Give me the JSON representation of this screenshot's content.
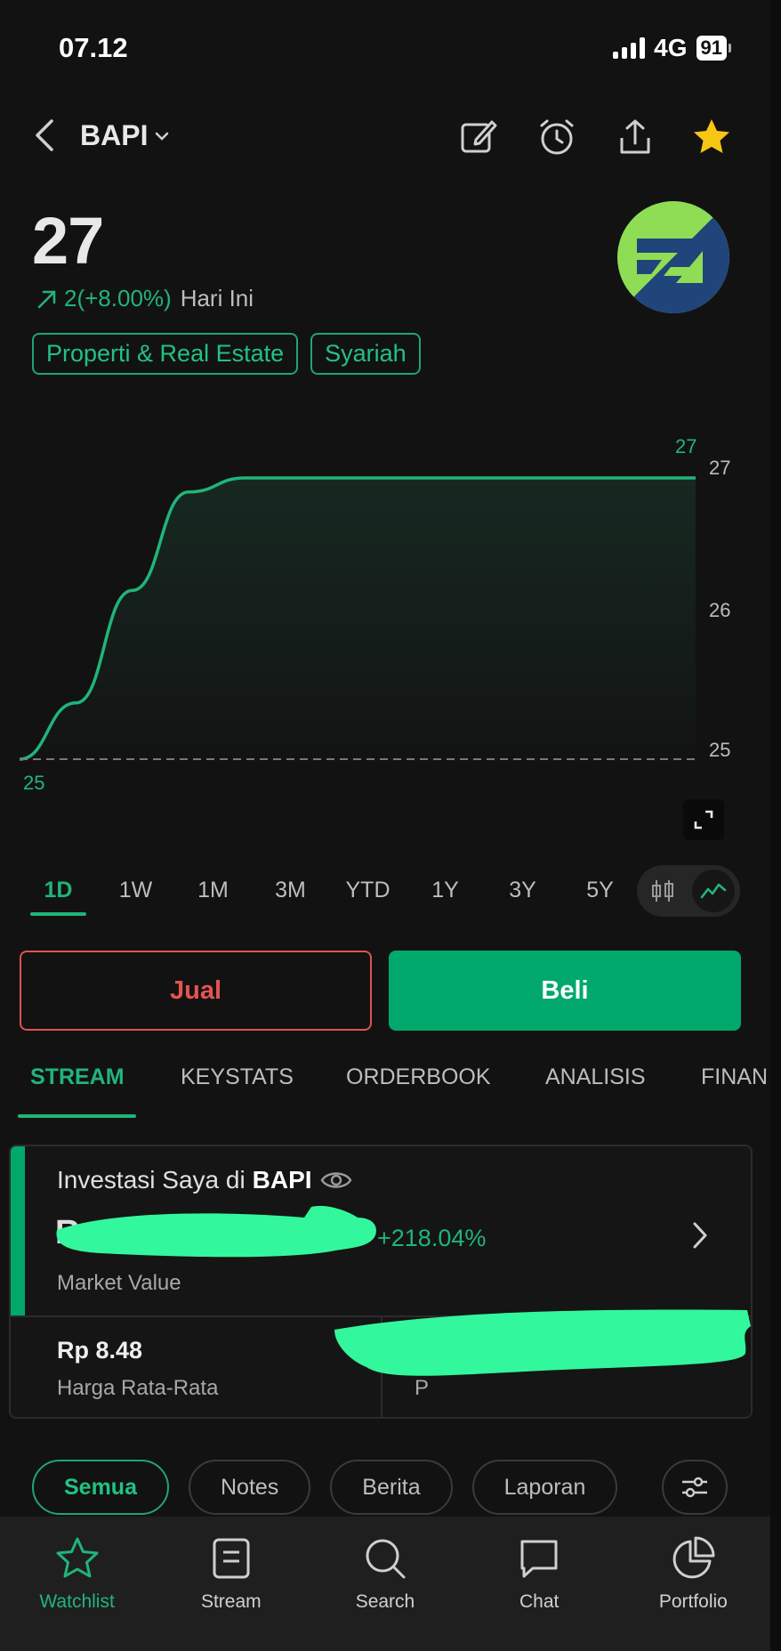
{
  "status_bar": {
    "time": "07.12",
    "network": "4G",
    "battery": "91"
  },
  "header": {
    "ticker": "BAPI"
  },
  "quote": {
    "price": "27",
    "change": "2(+8.00%)",
    "change_label": "Hari Ini",
    "tags": [
      "Properti & Real Estate",
      "Syariah"
    ]
  },
  "chart_data": {
    "type": "line",
    "series": [
      {
        "values": [
          25,
          25.4,
          26.2,
          26.9,
          27,
          27,
          27,
          27,
          27,
          27,
          27,
          27,
          27
        ]
      }
    ],
    "x": [
      0,
      1,
      2,
      3,
      4,
      5,
      6,
      7,
      8,
      9,
      10,
      11,
      12
    ],
    "y_ticks": [
      "27",
      "26",
      "25"
    ],
    "ylim": [
      25,
      27
    ],
    "high_label": "27",
    "low_label": "25",
    "baseline": 25,
    "line_color": "#20b57a"
  },
  "ranges": [
    "1D",
    "1W",
    "1M",
    "3M",
    "YTD",
    "1Y",
    "3Y",
    "5Y"
  ],
  "actions": {
    "sell": "Jual",
    "buy": "Beli"
  },
  "sections": [
    "STREAM",
    "KEYSTATS",
    "ORDERBOOK",
    "ANALISIS",
    "FINAN"
  ],
  "investment": {
    "title_prefix": "Investasi Saya di",
    "title_ticker": "BAPI",
    "market_value": "Rp",
    "market_value_pct": "+218.04%",
    "market_value_label": "Market Value",
    "avg_price": "Rp 8.48",
    "avg_price_label": "Harga Rata-Rata",
    "pl_value": "R",
    "pl_label": "P"
  },
  "filters": [
    "Semua",
    "Notes",
    "Berita",
    "Laporan"
  ],
  "nav": [
    "Watchlist",
    "Stream",
    "Search",
    "Chat",
    "Portfolio"
  ],
  "colors": {
    "accent": "#20b57a",
    "sell": "#e5534f",
    "buy": "#00a96b",
    "star": "#f7c514"
  }
}
